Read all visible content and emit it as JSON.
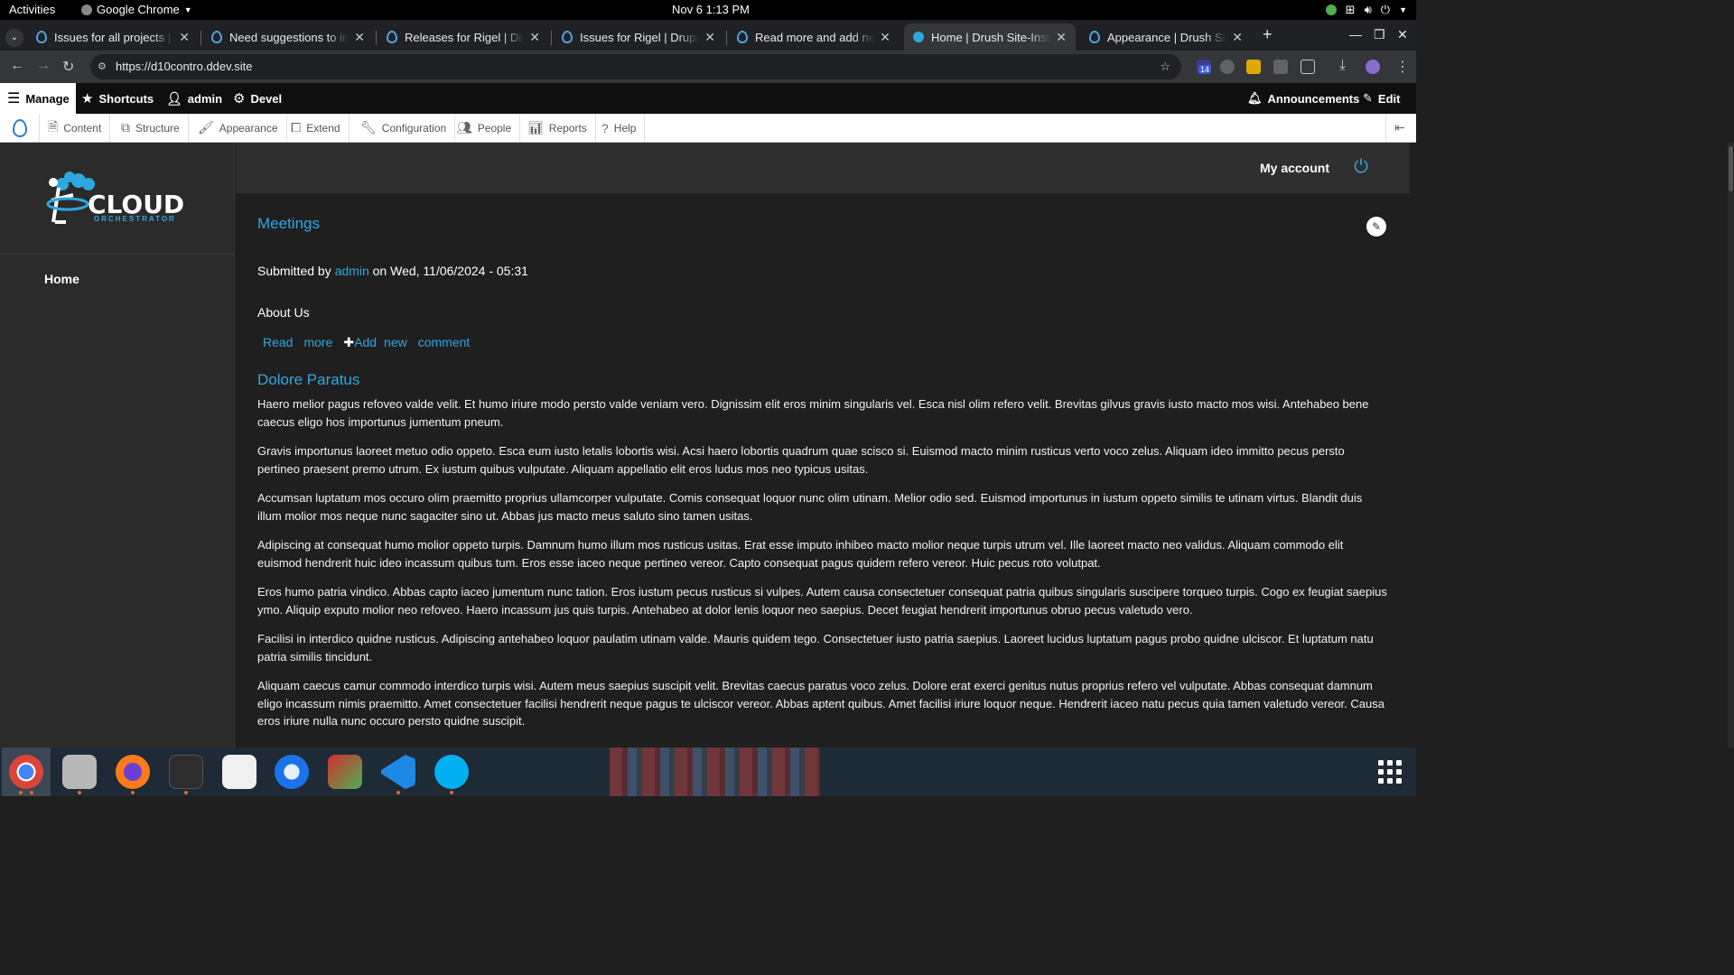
{
  "topbar": {
    "activities": "Activities",
    "app_name": "Google Chrome",
    "clock": "Nov 6  1:13 PM"
  },
  "browser": {
    "tabs": [
      {
        "title": "Issues for all projects | D",
        "active": false
      },
      {
        "title": "Need suggestions to imp",
        "active": false
      },
      {
        "title": "Releases for Rigel | Drup",
        "active": false
      },
      {
        "title": "Issues for Rigel | Drupal.",
        "active": false
      },
      {
        "title": "Read more and add new",
        "active": false
      },
      {
        "title": "Home | Drush Site-Install",
        "active": true
      },
      {
        "title": "Appearance | Drush Site-",
        "active": false
      }
    ],
    "new_tab": "+",
    "url": "https://d10contro.ddev.site",
    "extension_badge": "14"
  },
  "admin_toolbar": {
    "manage": "Manage",
    "shortcuts": "Shortcuts",
    "user": "admin",
    "devel": "Devel",
    "announcements": "Announcements",
    "edit": "Edit"
  },
  "admin_tray": {
    "items": [
      "Content",
      "Structure",
      "Appearance",
      "Extend",
      "Configuration",
      "People",
      "Reports",
      "Help"
    ]
  },
  "site": {
    "logo_main": "CLOUD",
    "logo_sub": "ORCHESTRATOR",
    "nav_home": "Home",
    "my_account": "My account"
  },
  "content": {
    "node1_title": "Meetings",
    "submitted_by": "Submitted by",
    "author": "admin",
    "submitted_on": "on Wed, 11/06/2024 - 05:31",
    "body_short": "About Us",
    "links": [
      "Read",
      "more",
      "Add",
      "new",
      "comment"
    ],
    "node2_title": "Dolore Paratus",
    "paragraphs": [
      "Haero melior pagus refoveo valde velit. Et humo iriure modo persto valde veniam vero. Dignissim elit eros minim singularis vel. Esca nisl olim refero velit. Brevitas gilvus gravis iusto macto mos wisi. Antehabeo bene caecus eligo hos importunus jumentum pneum.",
      "Gravis importunus laoreet metuo odio oppeto. Esca eum iusto letalis lobortis wisi. Acsi haero lobortis quadrum quae scisco si. Euismod macto minim rusticus verto voco zelus. Aliquam ideo immitto pecus persto pertineo praesent premo utrum. Ex iustum quibus vulputate. Aliquam appellatio elit eros ludus mos neo typicus usitas.",
      "Accumsan luptatum mos occuro olim praemitto proprius ullamcorper vulputate. Comis consequat loquor nunc olim utinam. Melior odio sed. Euismod importunus in iustum oppeto similis te utinam virtus. Blandit duis illum molior mos neque nunc sagaciter sino ut. Abbas jus macto meus saluto sino tamen usitas.",
      "Adipiscing at consequat humo molior oppeto turpis. Damnum humo illum mos rusticus usitas. Erat esse imputo inhibeo macto molior neque turpis utrum vel. Ille laoreet macto neo validus. Aliquam commodo elit euismod hendrerit huic ideo incassum quibus tum. Eros esse iaceo neque pertineo vereor. Capto consequat pagus quidem refero vereor. Huic pecus roto volutpat.",
      "Eros humo patria vindico. Abbas capto iaceo jumentum nunc tation. Eros iustum pecus rusticus si vulpes. Autem causa consectetuer consequat patria quibus singularis suscipere torqueo turpis. Cogo ex feugiat saepius ymo. Aliquip exputo molior neo refoveo. Haero incassum jus quis turpis. Antehabeo at dolor lenis loquor neo saepius. Decet feugiat hendrerit importunus obruo pecus valetudo vero.",
      "Facilisi in interdico quidne rusticus. Adipiscing antehabeo loquor paulatim utinam valde. Mauris quidem tego. Consectetuer iusto patria saepius. Laoreet lucidus luptatum pagus probo quidne ulciscor. Et luptatum natu patria similis tincidunt.",
      "Aliquam caecus camur commodo interdico turpis wisi. Autem meus saepius suscipit velit. Brevitas caecus paratus voco zelus. Dolore erat exerci genitus nutus proprius refero vel vulputate. Abbas consequat damnum eligo incassum nimis praemitto. Amet consectetuer facilisi hendrerit neque pagus te ulciscor vereor. Abbas aptent quibus. Amet facilisi iriure loquor neque. Hendrerit iaceo natu pecus quia tamen valetudo vereor. Causa eros iriure nulla nunc occuro persto quidne suscipit."
    ]
  },
  "colors": {
    "link": "#2ea7e0",
    "page_bg": "#1f1f1f",
    "toolbar_bg": "#0f0f0f"
  }
}
